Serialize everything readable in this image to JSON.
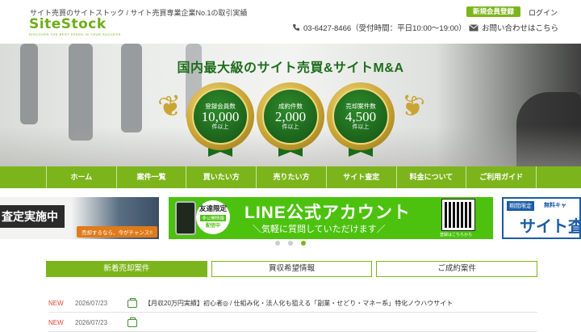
{
  "header": {
    "tagline": "サイト売買のサイトストック / サイト売買専業企業No.1の取引実績",
    "logo": "SiteStock",
    "logo_sub": "DISCOVER THE BEST SPEED IN YOUR SUCCESS",
    "register_label": "新規会員登録",
    "login_label": "ログイン",
    "phone": "03-6427-8466（受付時間：平日10:00〜19:00）",
    "contact_label": "お問い合わせはこちら"
  },
  "hero": {
    "title": "国内最大級のサイト売買&サイトM&A",
    "medals": [
      {
        "label": "登録会員数",
        "value": "10,000",
        "unit": "件以上"
      },
      {
        "label": "成約件数",
        "value": "2,000",
        "unit": "件以上"
      },
      {
        "label": "売却案件数",
        "value": "4,500",
        "unit": "件以上"
      }
    ]
  },
  "nav": {
    "items": [
      "ホーム",
      "案件一覧",
      "買いたい方",
      "売りたい方",
      "サイト査定",
      "料金について",
      "ご利用ガイド"
    ]
  },
  "banners": {
    "appraisal": {
      "text": "査定実施中",
      "small": "売却するなら、今がチャンス!!"
    },
    "line": {
      "badge_top": "友達限定",
      "badge_mid": "非公開情報",
      "badge_bottom": "配信中",
      "title": "LINE公式アカウント",
      "sub": "＼気軽に質問していただけます／",
      "qr_label": "登録はこちらから"
    },
    "limited": {
      "tag": "期間限定",
      "tag2": "無料キャ",
      "big": "サイト査"
    }
  },
  "carousel": {
    "count": 3,
    "active": 2
  },
  "tabs": {
    "items": [
      "新着売却案件",
      "買収希望情報",
      "ご成約案件"
    ],
    "active": 0
  },
  "listings": [
    {
      "badge": "NEW",
      "date": "2026/07/23",
      "title": "【月収20万円実績】初心者◎ / 仕組み化・法人化も狙える「副業・せどり・マネー系」特化ノウハウサイト"
    },
    {
      "badge": "NEW",
      "date": "2026/07/23",
      "title": ""
    }
  ],
  "colors": {
    "brand": "#7cb51b",
    "dark_green": "#1e6d1c",
    "new": "#e34432"
  }
}
